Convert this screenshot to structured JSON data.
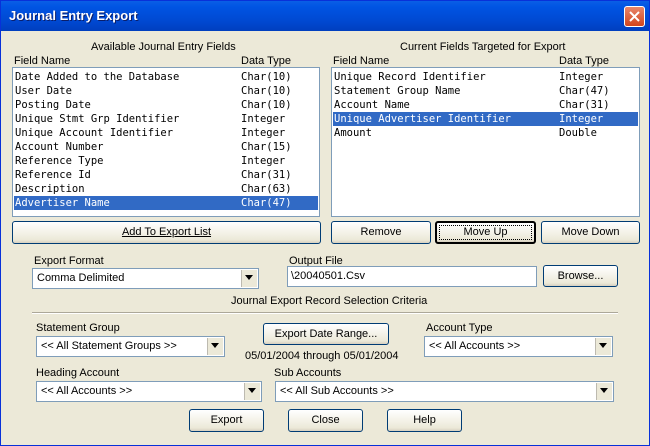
{
  "window": {
    "title": "Journal Entry Export"
  },
  "available": {
    "heading": "Available Journal Entry Fields",
    "col_field": "Field Name",
    "col_type": "Data Type",
    "rows": [
      {
        "name": "Date Added to the Database",
        "type": "Char(10)"
      },
      {
        "name": "User Date",
        "type": "Char(10)"
      },
      {
        "name": "Posting Date",
        "type": "Char(10)"
      },
      {
        "name": "Unique Stmt Grp Identifier",
        "type": "Integer"
      },
      {
        "name": "Unique Account Identifier",
        "type": "Integer"
      },
      {
        "name": "Account Number",
        "type": "Char(15)"
      },
      {
        "name": "Reference Type",
        "type": "Integer"
      },
      {
        "name": "Reference Id",
        "type": "Char(31)"
      },
      {
        "name": "Description",
        "type": "Char(63)"
      },
      {
        "name": "Advertiser Name",
        "type": "Char(47)"
      }
    ],
    "selected_index": 9,
    "add_button": "Add To Export List"
  },
  "current": {
    "heading": "Current Fields Targeted for Export",
    "col_field": "Field Name",
    "col_type": "Data Type",
    "rows": [
      {
        "name": "Unique Record Identifier",
        "type": "Integer"
      },
      {
        "name": "Statement Group Name",
        "type": "Char(47)"
      },
      {
        "name": "Account Name",
        "type": "Char(31)"
      },
      {
        "name": "Unique Advertiser Identifier",
        "type": "Integer"
      },
      {
        "name": "Amount",
        "type": "Double"
      }
    ],
    "selected_index": 3,
    "remove_button": "Remove",
    "move_up_button": "Move Up",
    "move_down_button": "Move Down"
  },
  "export_format": {
    "label": "Export Format",
    "value": "Comma Delimited"
  },
  "output_file": {
    "label": "Output File",
    "value": "\\20040501.Csv",
    "browse_button": "Browse..."
  },
  "criteria": {
    "heading": "Journal Export Record Selection Criteria",
    "statement_group": {
      "label": "Statement Group",
      "value": "<< All Statement Groups >>"
    },
    "date_range_button": "Export Date Range...",
    "date_range_text": "05/01/2004 through 05/01/2004",
    "account_type": {
      "label": "Account Type",
      "value": "<< All Accounts >>"
    },
    "heading_account": {
      "label": "Heading Account",
      "value": "<< All Accounts >>"
    },
    "sub_accounts": {
      "label": "Sub Accounts",
      "value": "<< All Sub Accounts >>"
    }
  },
  "buttons": {
    "export": "Export",
    "close": "Close",
    "help": "Help"
  }
}
